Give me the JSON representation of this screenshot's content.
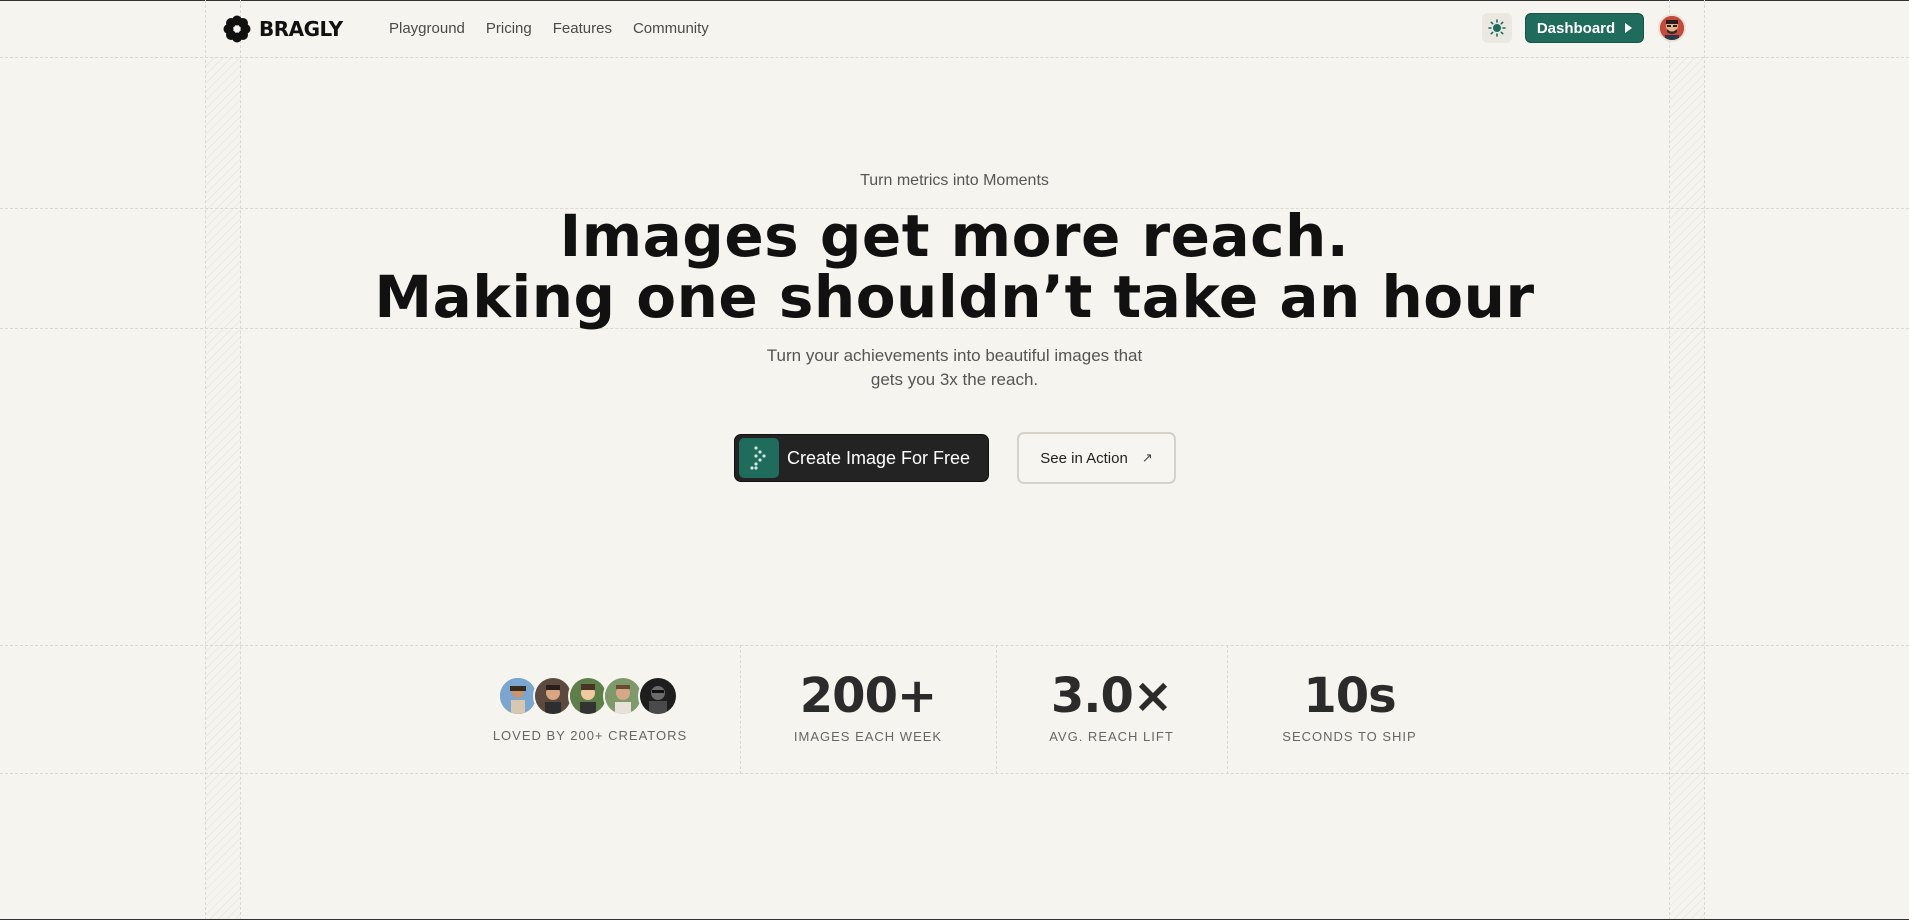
{
  "brand": {
    "name": "BRAGLY"
  },
  "nav": {
    "items": [
      "Playground",
      "Pricing",
      "Features",
      "Community"
    ]
  },
  "header": {
    "dashboard_label": "Dashboard",
    "theme_icon": "sun-icon"
  },
  "hero": {
    "eyebrow": "Turn metrics into Moments",
    "headline_line1": "Images get more reach.",
    "headline_line2": "Making one shouldn’t take an hour",
    "subhead_line1": "Turn your achievements into beautiful images that",
    "subhead_line2": "gets you 3x the reach.",
    "cta_primary": "Create Image For Free",
    "cta_secondary": "See in Action"
  },
  "stats": [
    {
      "value": "",
      "label": "LOVED BY 200+ CREATORS"
    },
    {
      "value": "200+",
      "label": "IMAGES EACH WEEK"
    },
    {
      "value": "3.0×",
      "label": "AVG. REACH LIFT"
    },
    {
      "value": "10s",
      "label": "SECONDS TO SHIP"
    }
  ],
  "colors": {
    "accent": "#1f6b5c",
    "background": "#f6f4ef",
    "dark_button": "#232323"
  }
}
